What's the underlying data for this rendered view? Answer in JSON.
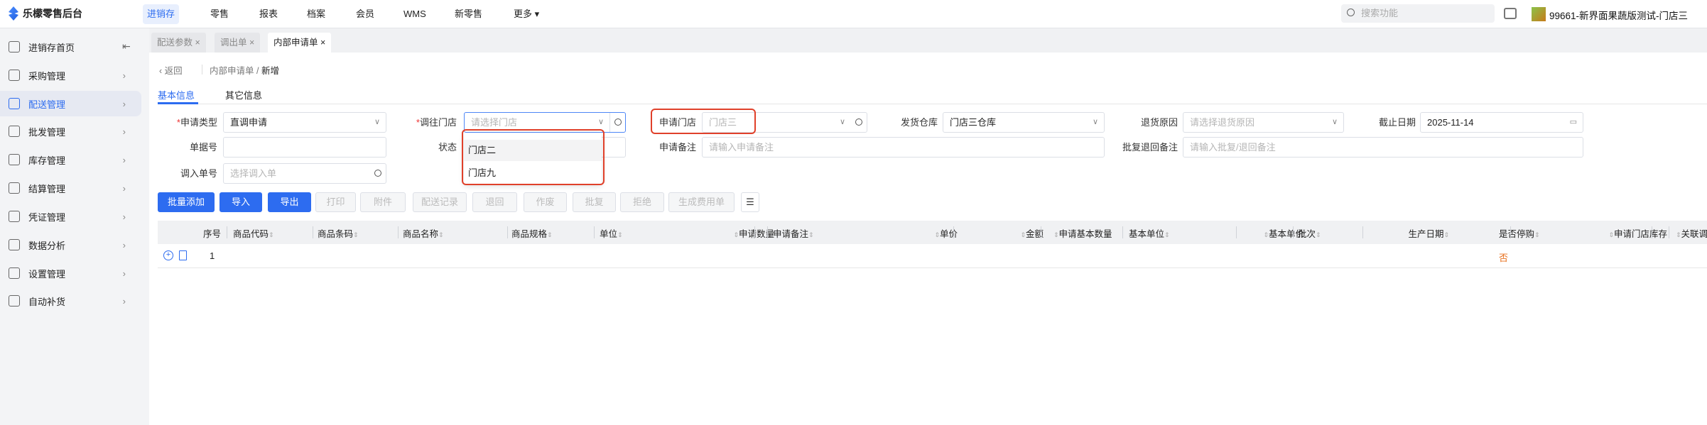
{
  "app": {
    "title": "乐檬零售后台"
  },
  "topnav": {
    "items": [
      "进销存",
      "零售",
      "报表",
      "档案",
      "会员",
      "WMS",
      "新零售",
      "更多"
    ],
    "active": "进销存"
  },
  "header": {
    "search_placeholder": "搜索功能",
    "store_name": "99661-新界面果蔬版测试-门店三"
  },
  "sidebar": {
    "items": [
      "进销存首页",
      "采购管理",
      "配送管理",
      "批发管理",
      "库存管理",
      "结算管理",
      "凭证管理",
      "数据分析",
      "设置管理",
      "自动补货"
    ],
    "active": "配送管理"
  },
  "tabs": [
    {
      "label": "配送参数"
    },
    {
      "label": "调出单"
    },
    {
      "label": "内部申请单"
    }
  ],
  "breadcrumb": {
    "back": "返回",
    "parent": "内部申请单",
    "sep": "/",
    "current": "新增"
  },
  "subtabs": [
    "基本信息",
    "其它信息"
  ],
  "form": {
    "apply_type": {
      "label": "申请类型",
      "value": "直调申请"
    },
    "to_store": {
      "label": "调往门店",
      "placeholder": "请选择门店"
    },
    "apply_store": {
      "label": "申请门店",
      "value": "门店三"
    },
    "ship_warehouse": {
      "label": "发货仓库",
      "value": "门店三仓库"
    },
    "return_reason": {
      "label": "退货原因",
      "placeholder": "请选择退货原因"
    },
    "deadline": {
      "label": "截止日期",
      "value": "2025-11-14"
    },
    "doc_no": {
      "label": "单据号",
      "value": ""
    },
    "status": {
      "label": "状态"
    },
    "apply_remark": {
      "label": "申请备注",
      "placeholder": "请输入申请备注"
    },
    "reply_remark": {
      "label": "批复退回备注",
      "placeholder": "请输入批复/退回备注"
    },
    "in_doc_no": {
      "label": "调入单号",
      "placeholder": "选择调入单"
    }
  },
  "dropdown": {
    "options": [
      "门店二",
      "门店九"
    ],
    "highlighted": "门店二"
  },
  "toolbar": [
    "批量添加",
    "导入",
    "导出",
    "打印",
    "附件",
    "配送记录",
    "退回",
    "作废",
    "批复",
    "拒绝",
    "生成费用单"
  ],
  "table": {
    "columns": [
      "序号",
      "商品代码",
      "商品条码",
      "商品名称",
      "商品规格",
      "单位",
      "申请数量",
      "申请备注",
      "单价",
      "金额",
      "申请基本数量",
      "基本单位",
      "基本单价",
      "批次",
      "生产日期",
      "是否停购",
      "申请门店库存",
      "关联调"
    ],
    "rows": [
      {
        "index": "1",
        "stop_purchase": "否"
      }
    ]
  },
  "colors": {
    "accent": "#2d6cf0",
    "highlight_box": "#e0402a",
    "stop_no": "#e8711f"
  }
}
